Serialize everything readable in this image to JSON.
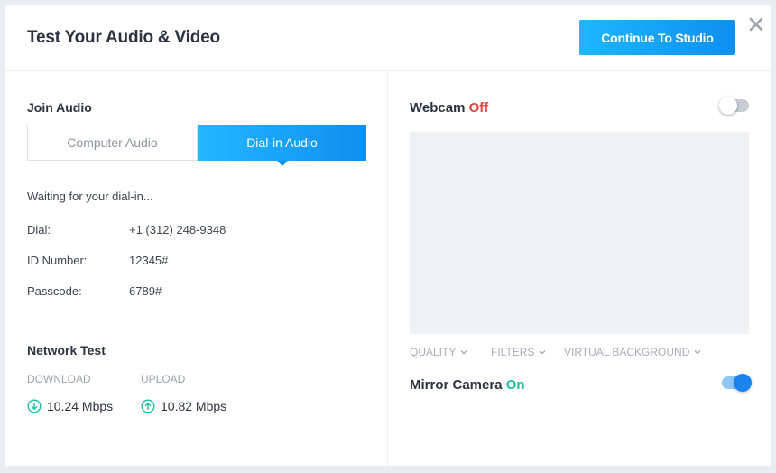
{
  "header": {
    "title": "Test Your Audio & Video",
    "continue_label": "Continue To Studio"
  },
  "join_audio": {
    "heading": "Join Audio",
    "tabs": [
      {
        "label": "Computer Audio",
        "selected": false
      },
      {
        "label": "Dial-in Audio",
        "selected": true
      }
    ],
    "status": "Waiting for your dial-in...",
    "rows": [
      {
        "label": "Dial:",
        "value": "+1 (312) 248-9348"
      },
      {
        "label": "ID Number:",
        "value": "12345#"
      },
      {
        "label": "Passcode:",
        "value": "6789#"
      }
    ]
  },
  "network": {
    "heading": "Network Test",
    "download_label": "DOWNLOAD",
    "upload_label": "UPLOAD",
    "download_value": "10.24 Mbps",
    "upload_value": "10.82 Mbps"
  },
  "webcam": {
    "label": "Webcam",
    "state": "Off",
    "enabled": false,
    "options": [
      "QUALITY",
      "FILTERS",
      "VIRTUAL BACKGROUND"
    ]
  },
  "mirror": {
    "label": "Mirror Camera",
    "state": "On",
    "enabled": true
  },
  "colors": {
    "accent": "#0d8ff0",
    "off": "#e0423f",
    "on": "#1bbfa2"
  },
  "icons": [
    "close-icon",
    "download-arrow-icon",
    "upload-arrow-icon",
    "chevron-down-icon"
  ]
}
